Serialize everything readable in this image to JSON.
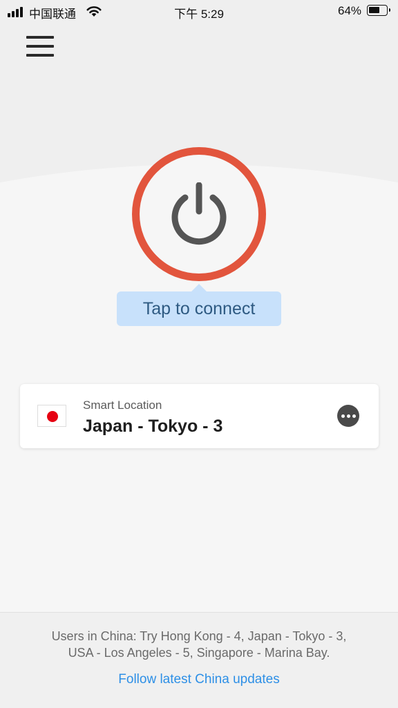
{
  "status_bar": {
    "carrier": "中国联通",
    "time": "下午 5:29",
    "battery_percent": "64%",
    "battery_level": 0.64
  },
  "header": {
    "menu_icon": "hamburger-menu-icon"
  },
  "connect": {
    "power_icon": "power-icon",
    "ring_color": "#e2553d",
    "tooltip": "Tap to connect"
  },
  "location": {
    "label": "Smart Location",
    "name": "Japan - Tokyo - 3",
    "flag_icon": "japan-flag-icon",
    "more_icon": "more-options-icon"
  },
  "footer": {
    "notice_line1": "Users in China: Try Hong Kong - 4, Japan - Tokyo - 3,",
    "notice_line2": "USA - Los Angeles - 5, Singapore - Marina Bay.",
    "link": "Follow latest China updates",
    "link_color": "#2d8fe6"
  }
}
